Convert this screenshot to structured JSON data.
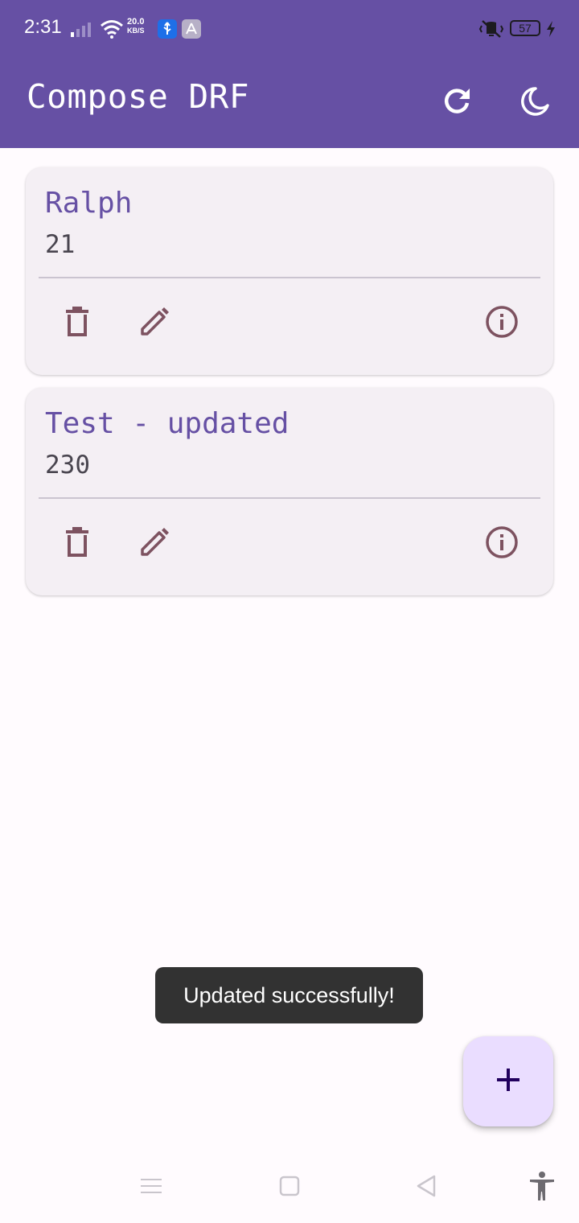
{
  "status_bar": {
    "time": "2:31",
    "net_speed_value": "20.0",
    "net_speed_unit": "KB/S",
    "battery_level": "57",
    "icons": [
      "signal-icon",
      "wifi-icon",
      "usb-icon",
      "app-notification-icon",
      "vibrate-off-icon",
      "battery-icon",
      "charging-icon"
    ]
  },
  "app_bar": {
    "title": "Compose DRF",
    "actions": [
      "refresh-icon",
      "dark-mode-icon"
    ]
  },
  "items": [
    {
      "name": "Ralph",
      "value": "21"
    },
    {
      "name": "Test - updated",
      "value": "230"
    }
  ],
  "card_actions": [
    "delete-icon",
    "edit-icon",
    "info-icon"
  ],
  "toast": {
    "message": "Updated successfully!"
  },
  "fab": {
    "icon": "add-icon"
  },
  "nav_bar": {
    "icons": [
      "recents-icon",
      "home-icon",
      "back-icon",
      "accessibility-icon"
    ]
  },
  "colors": {
    "primary": "#6650a4",
    "card_background": "#f4eff4",
    "icon_tint": "#7d5260",
    "fab_background": "#eaddff",
    "toast_background": "#323232"
  }
}
